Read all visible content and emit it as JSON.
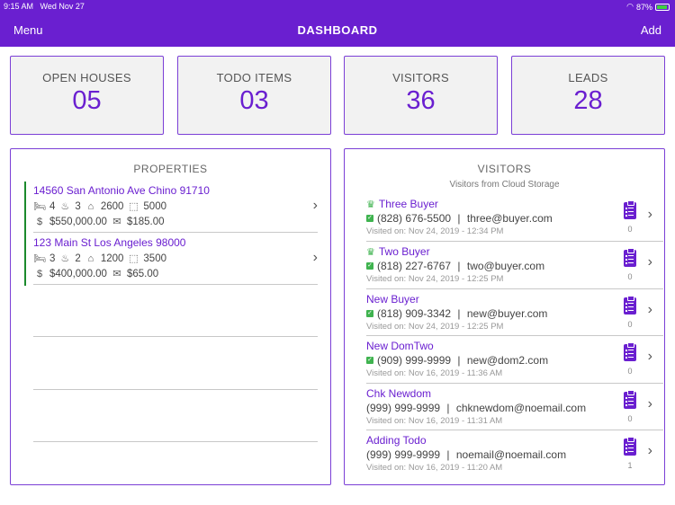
{
  "status": {
    "time": "9:15 AM",
    "date": "Wed Nov 27",
    "battery": "87%"
  },
  "nav": {
    "menu": "Menu",
    "title": "DASHBOARD",
    "add": "Add"
  },
  "stats": [
    {
      "label": "OPEN HOUSES",
      "value": "05"
    },
    {
      "label": "TODO ITEMS",
      "value": "03"
    },
    {
      "label": "VISITORS",
      "value": "36"
    },
    {
      "label": "LEADS",
      "value": "28"
    }
  ],
  "properties": {
    "title": "PROPERTIES",
    "items": [
      {
        "address": "14560 San Antonio Ave Chino 91710",
        "beds": "4",
        "baths": "3",
        "sqft": "2600",
        "lot": "5000",
        "price": "$550,000.00",
        "fee": "$185.00"
      },
      {
        "address": "123 Main St Los Angeles 98000",
        "beds": "3",
        "baths": "2",
        "sqft": "1200",
        "lot": "3500",
        "price": "$400,000.00",
        "fee": "$65.00"
      }
    ]
  },
  "visitors": {
    "title": "VISITORS",
    "subtitle": "Visitors from Cloud Storage",
    "items": [
      {
        "name": "Three Buyer",
        "phone": "(828) 676-5500",
        "email": "three@buyer.com",
        "visited": "Visited on:  Nov 24, 2019 - 12:34 PM",
        "count": "0"
      },
      {
        "name": "Two Buyer",
        "phone": "(818) 227-6767",
        "email": "two@buyer.com",
        "visited": "Visited on:  Nov 24, 2019 - 12:25 PM",
        "count": "0"
      },
      {
        "name": "New Buyer",
        "phone": "(818) 909-3342",
        "email": "new@buyer.com",
        "visited": "Visited on:  Nov 24, 2019 - 12:25 PM",
        "count": "0"
      },
      {
        "name": "New DomTwo",
        "phone": "(909) 999-9999",
        "email": "new@dom2.com",
        "visited": "Visited on:  Nov 16, 2019 - 11:36 AM",
        "count": "0"
      },
      {
        "name": "Chk Newdom",
        "phone": "(999) 999-9999",
        "email": "chknewdom@noemail.com",
        "visited": "Visited on:  Nov 16, 2019 - 11:31 AM",
        "count": "0"
      },
      {
        "name": "Adding Todo",
        "phone": "(999) 999-9999",
        "email": "noemail@noemail.com",
        "visited": "Visited on:  Nov 16, 2019 - 11:20 AM",
        "count": "1"
      }
    ]
  },
  "colors": {
    "brand": "#6a1fd0",
    "accent_green": "#3fb34f",
    "property_bar": "#1c8a2c"
  }
}
